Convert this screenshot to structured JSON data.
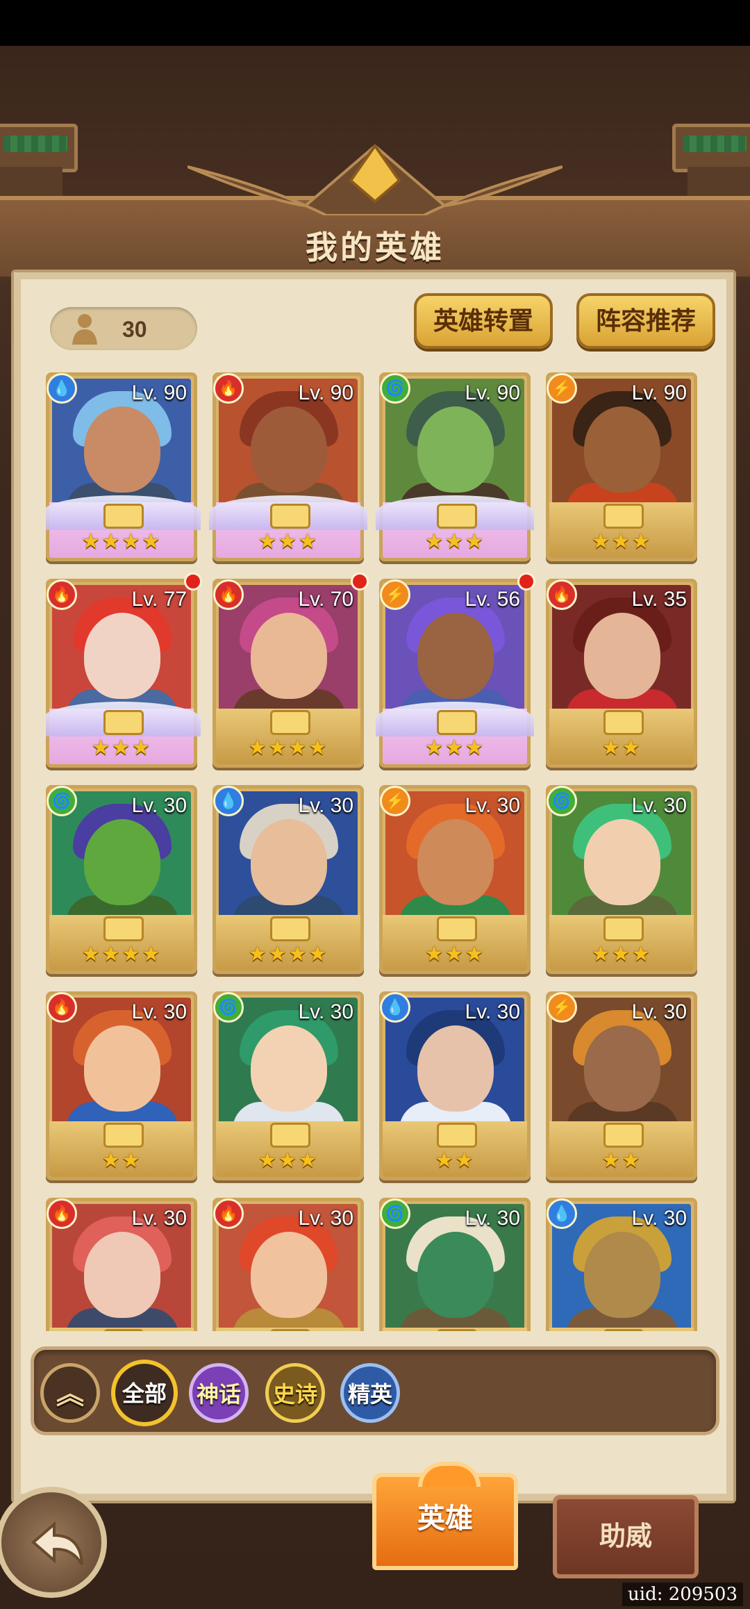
{
  "header": {
    "title": "我的英雄"
  },
  "hero_count": "30",
  "buttons": {
    "transfer": "英雄转置",
    "lineup": "阵容推荐"
  },
  "heroes": [
    {
      "level": "Lv. 90",
      "element": "water",
      "stars": "★★★★",
      "rarity": "mythic",
      "dot": false
    },
    {
      "level": "Lv. 90",
      "element": "fire",
      "stars": "★★★",
      "rarity": "mythic",
      "dot": false
    },
    {
      "level": "Lv. 90",
      "element": "nature",
      "stars": "★★★",
      "rarity": "mythic",
      "dot": false
    },
    {
      "level": "Lv. 90",
      "element": "light",
      "stars": "★★★",
      "rarity": "epic",
      "dot": false
    },
    {
      "level": "Lv. 77",
      "element": "fire",
      "stars": "★★★",
      "rarity": "mythic",
      "dot": true
    },
    {
      "level": "Lv. 70",
      "element": "fire",
      "stars": "★★★★",
      "rarity": "epic",
      "dot": true
    },
    {
      "level": "Lv. 56",
      "element": "light",
      "stars": "★★★",
      "rarity": "mythic",
      "dot": true
    },
    {
      "level": "Lv. 35",
      "element": "fire",
      "stars": "★★",
      "rarity": "epic",
      "dot": false
    },
    {
      "level": "Lv. 30",
      "element": "nature",
      "stars": "★★★★",
      "rarity": "epic",
      "dot": false
    },
    {
      "level": "Lv. 30",
      "element": "water",
      "stars": "★★★★",
      "rarity": "epic",
      "dot": false
    },
    {
      "level": "Lv. 30",
      "element": "light",
      "stars": "★★★",
      "rarity": "epic",
      "dot": false
    },
    {
      "level": "Lv. 30",
      "element": "nature",
      "stars": "★★★",
      "rarity": "epic",
      "dot": false
    },
    {
      "level": "Lv. 30",
      "element": "fire",
      "stars": "★★",
      "rarity": "epic",
      "dot": false
    },
    {
      "level": "Lv. 30",
      "element": "nature",
      "stars": "★★★",
      "rarity": "epic",
      "dot": false
    },
    {
      "level": "Lv. 30",
      "element": "water",
      "stars": "★★",
      "rarity": "epic",
      "dot": false
    },
    {
      "level": "Lv. 30",
      "element": "light",
      "stars": "★★",
      "rarity": "epic",
      "dot": false
    },
    {
      "level": "Lv. 30",
      "element": "fire",
      "stars": "",
      "rarity": "epic",
      "dot": false
    },
    {
      "level": "Lv. 30",
      "element": "fire",
      "stars": "",
      "rarity": "epic",
      "dot": false
    },
    {
      "level": "Lv. 30",
      "element": "nature",
      "stars": "",
      "rarity": "epic",
      "dot": false
    },
    {
      "level": "Lv. 30",
      "element": "water",
      "stars": "",
      "rarity": "epic",
      "dot": false
    }
  ],
  "portrait_colors": [
    {
      "bg": "#3d5fa8",
      "skin": "#c98a66",
      "hair": "#7fbde8",
      "body": "#3b4f6e"
    },
    {
      "bg": "#b9522f",
      "skin": "#9e5b3a",
      "hair": "#8a3621",
      "body": "#7a5030"
    },
    {
      "bg": "#5f8a3e",
      "skin": "#7fb35a",
      "hair": "#3e5d4a",
      "body": "#4a3a2a"
    },
    {
      "bg": "#8a4a28",
      "skin": "#9a6038",
      "hair": "#3a2416",
      "body": "#c8421d"
    },
    {
      "bg": "#c9473a",
      "skin": "#f1d3c6",
      "hair": "#e2392d",
      "body": "#4a6aa0"
    },
    {
      "bg": "#9a3e6a",
      "skin": "#e9b894",
      "hair": "#c44a8a",
      "body": "#6a3a2c"
    },
    {
      "bg": "#6a52b8",
      "skin": "#9a6342",
      "hair": "#7a56d8",
      "body": "#4a5fb0"
    },
    {
      "bg": "#7a2a26",
      "skin": "#e4b596",
      "hair": "#6a1e1a",
      "body": "#c82a2e"
    },
    {
      "bg": "#2f8a5a",
      "skin": "#5ea83e",
      "hair": "#4a3ea0",
      "body": "#3a6a2e"
    },
    {
      "bg": "#2e4f9a",
      "skin": "#e7bd9a",
      "hair": "#d8d2c6",
      "body": "#2c4a72"
    },
    {
      "bg": "#c8542c",
      "skin": "#cf8a5a",
      "hair": "#e46a2a",
      "body": "#2f8a4a"
    },
    {
      "bg": "#4f8a3a",
      "skin": "#f1cfae",
      "hair": "#3ec07a",
      "body": "#5a6a3a"
    },
    {
      "bg": "#b2452c",
      "skin": "#f1c29a",
      "hair": "#d8622e",
      "body": "#2f62b8"
    },
    {
      "bg": "#2f7a4e",
      "skin": "#f3d2b3",
      "hair": "#2f9a6a",
      "body": "#dfe6ee"
    },
    {
      "bg": "#2a4a9a",
      "skin": "#e6c2ab",
      "hair": "#1e3a78",
      "body": "#e8eef8"
    },
    {
      "bg": "#7a4a2c",
      "skin": "#9a6a4a",
      "hair": "#d98a2e",
      "body": "#5a3a24"
    },
    {
      "bg": "#b8473a",
      "skin": "#f0c8b6",
      "hair": "#e0605a",
      "body": "#3e4a6a"
    },
    {
      "bg": "#c2553a",
      "skin": "#f0c29e",
      "hair": "#e0482a",
      "body": "#b88a3a"
    },
    {
      "bg": "#3a7a4a",
      "skin": "#3a8a5a",
      "hair": "#eae2c8",
      "body": "#6a5a3a"
    },
    {
      "bg": "#2e6ab8",
      "skin": "#b08a4a",
      "hair": "#c9a03a",
      "body": "#7a5a3a"
    }
  ],
  "filters": {
    "collapse": "︽",
    "all": "全部",
    "mythic": "神话",
    "epic": "史诗",
    "elite": "精英"
  },
  "tabs": {
    "heroes": "英雄",
    "support": "助威"
  },
  "uid": "uid: 209503"
}
